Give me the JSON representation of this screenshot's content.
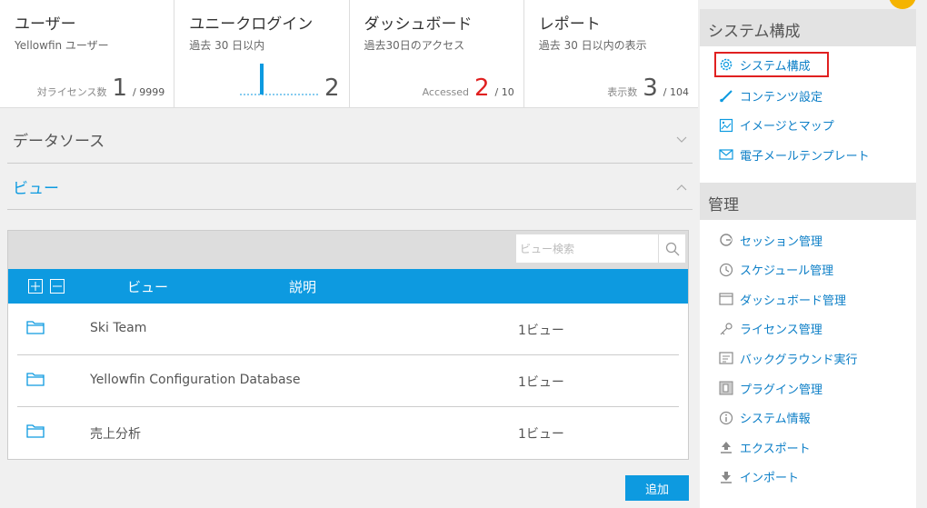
{
  "cards": [
    {
      "title": "ユーザー",
      "sub": "Yellowfin ユーザー",
      "label": "対ライセンス数",
      "big": "1",
      "small": "/ 9999"
    },
    {
      "title": "ユニークログイン",
      "sub": "過去 30 日以内",
      "label": "",
      "big": "2",
      "small": ""
    },
    {
      "title": "ダッシュボード",
      "sub": "過去30日のアクセス",
      "label": "Accessed",
      "big": "2",
      "small": "/ 10"
    },
    {
      "title": "レポート",
      "sub": "過去 30 日以内の表示",
      "label": "表示数",
      "big": "3",
      "small": "/ 104"
    }
  ],
  "accent": "#0d9ae0",
  "sections": {
    "datasource": "データソース",
    "view": "ビュー"
  },
  "panel": {
    "search_placeholder": "ビュー検索",
    "col_view": "ビュー",
    "col_desc": "説明",
    "rows": [
      {
        "name": "Ski Team",
        "count": "1ビュー"
      },
      {
        "name": "Yellowfin Configuration Database",
        "count": "1ビュー"
      },
      {
        "name": "売上分析",
        "count": "1ビュー"
      }
    ],
    "add_label": "追加"
  },
  "sidebar": {
    "config_title": "システム構成",
    "config_items": [
      {
        "label": "システム構成",
        "icon": "gear-icon"
      },
      {
        "label": "コンテンツ設定",
        "icon": "brush-icon"
      },
      {
        "label": "イメージとマップ",
        "icon": "image-icon"
      },
      {
        "label": "電子メールテンプレート",
        "icon": "mail-icon"
      }
    ],
    "admin_title": "管理",
    "admin_items": [
      {
        "label": "セッション管理",
        "icon": "session-icon"
      },
      {
        "label": "スケジュール管理",
        "icon": "clock-icon"
      },
      {
        "label": "ダッシュボード管理",
        "icon": "dashboard-icon"
      },
      {
        "label": "ライセンス管理",
        "icon": "key-icon"
      },
      {
        "label": "バックグラウンド実行",
        "icon": "background-icon"
      },
      {
        "label": "プラグイン管理",
        "icon": "plugin-icon"
      },
      {
        "label": "システム情報",
        "icon": "info-icon"
      },
      {
        "label": "エクスポート",
        "icon": "export-icon"
      },
      {
        "label": "インポート",
        "icon": "import-icon"
      }
    ]
  }
}
